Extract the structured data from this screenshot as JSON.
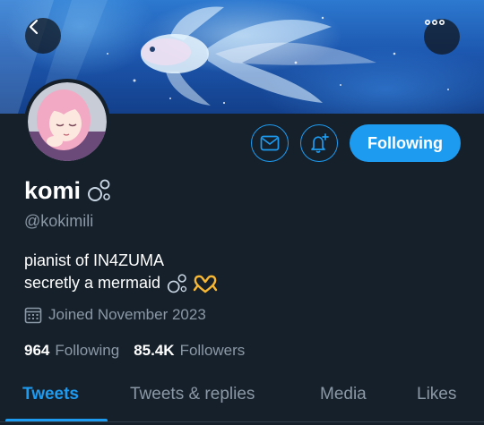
{
  "profile": {
    "display_name": "komi",
    "handle": "@kokimili",
    "bio_line1": "pianist of IN4ZUMA",
    "bio_line2": "secretly a mermaid",
    "joined": "Joined November 2023"
  },
  "actions": {
    "follow_label": "Following"
  },
  "stats": {
    "following_count": "964",
    "following_label": "Following",
    "followers_count": "85.4K",
    "followers_label": "Followers"
  },
  "tabs": [
    {
      "label": "Tweets",
      "active": true
    },
    {
      "label": "Tweets & replies",
      "active": false
    },
    {
      "label": "Media",
      "active": false
    },
    {
      "label": "Likes",
      "active": false
    }
  ],
  "icons": {
    "back": "back-arrow-icon",
    "more": "more-options-icon",
    "message": "mail-icon",
    "notify": "bell-plus-icon",
    "calendar": "calendar-icon",
    "bubbles": "bubbles-emoji",
    "heart_hands": "heart-hands-emoji"
  },
  "colors": {
    "accent": "#1d9bf0",
    "background": "#15202b",
    "secondary_text": "#8b98a5"
  }
}
